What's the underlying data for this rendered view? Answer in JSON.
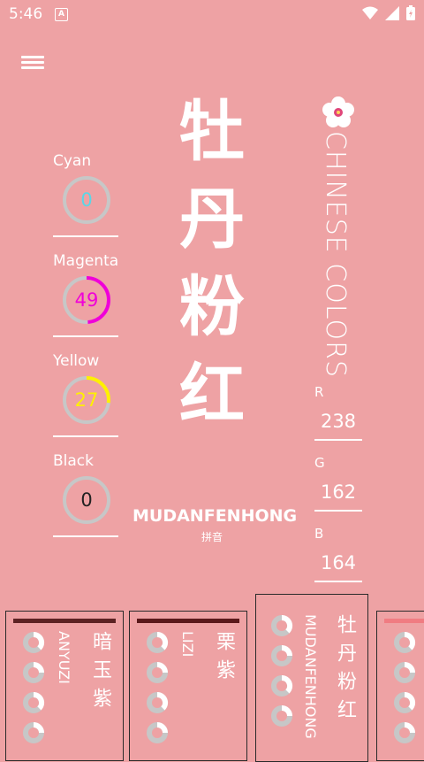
{
  "status": {
    "time": "5:46",
    "a_badge": "A"
  },
  "cmyk": [
    {
      "label": "Cyan",
      "value": "0",
      "percent": 0,
      "color": "#5ad6e6"
    },
    {
      "label": "Magenta",
      "value": "49",
      "percent": 49,
      "color": "#f000d8"
    },
    {
      "label": "Yellow",
      "value": "27",
      "percent": 27,
      "color": "#fff000"
    },
    {
      "label": "Black",
      "value": "0",
      "percent": 0,
      "color": "#222222"
    }
  ],
  "color": {
    "hanzi": [
      "牡",
      "丹",
      "粉",
      "红"
    ],
    "pinyin": "MUDANFENHONG",
    "pinyin_sub": "拼音",
    "title": "CHINESE COLORS"
  },
  "rgb": [
    {
      "label": "R",
      "value": "238"
    },
    {
      "label": "G",
      "value": "162"
    },
    {
      "label": "B",
      "value": "164"
    }
  ],
  "cards": [
    {
      "cn": "暗玉紫",
      "py": "ANYUZI",
      "bar_color": "#5c2223"
    },
    {
      "cn": "栗紫",
      "py": "LIZI",
      "bar_color": "#5a191b"
    },
    {
      "cn": "牡丹粉红",
      "py": "MUDANFENHONG",
      "bar_color": "#eea2a4"
    },
    {
      "cn": "",
      "py": "",
      "bar_color": "#f07c82"
    }
  ],
  "colors": {
    "background": "#eea2a4",
    "ring_track": "#c7c7c7",
    "text": "#ffffff"
  }
}
